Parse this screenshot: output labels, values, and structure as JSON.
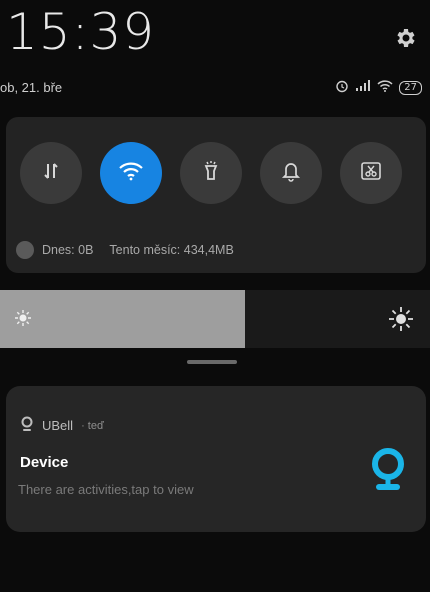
{
  "status_bar": {
    "time": "15:39",
    "date": "ob, 21. bře",
    "battery": "27",
    "icons": [
      "alarm-icon",
      "signal-icon",
      "wifi-icon",
      "battery-icon"
    ]
  },
  "quick_settings": {
    "toggles": [
      {
        "name": "mobile-data-toggle",
        "icon": "data-arrows-icon",
        "active": false
      },
      {
        "name": "wifi-toggle",
        "icon": "wifi-icon",
        "active": true
      },
      {
        "name": "flashlight-toggle",
        "icon": "flashlight-icon",
        "active": false
      },
      {
        "name": "sound-toggle",
        "icon": "bell-icon",
        "active": false
      },
      {
        "name": "screenshot-toggle",
        "icon": "scissors-icon",
        "active": false
      }
    ],
    "data_today": "Dnes: 0B",
    "data_month": "Tento měsíc: 434,4MB",
    "accent_color": "#1784e2"
  },
  "brightness": {
    "level": 0.57
  },
  "notification": {
    "app_name": "UBell",
    "time": "· teď",
    "title": "Device",
    "body": "There are activities,tap to view",
    "logo_color": "#1ab5e8"
  }
}
